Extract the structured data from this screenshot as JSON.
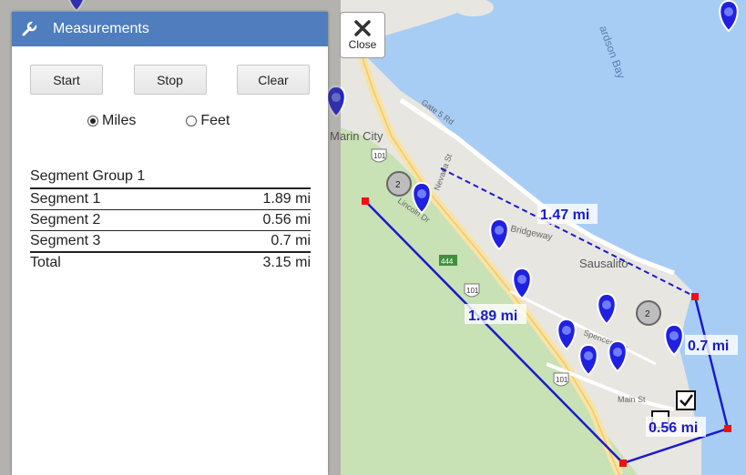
{
  "panel": {
    "title": "Measurements",
    "buttons": {
      "start": "Start",
      "stop": "Stop",
      "clear": "Clear"
    },
    "units": {
      "miles": "Miles",
      "feet": "Feet",
      "selected": "miles"
    },
    "group_title": "Segment Group 1",
    "segments": [
      {
        "label": "Segment 1",
        "value": "1.89 mi"
      },
      {
        "label": "Segment 2",
        "value": "0.56 mi"
      },
      {
        "label": "Segment 3",
        "value": "0.7 mi"
      }
    ],
    "total": {
      "label": "Total",
      "value": "3.15 mi"
    }
  },
  "close_button": {
    "label": "Close"
  },
  "map": {
    "place_labels": {
      "marin_city": "Marin City",
      "sausalito": "Sausalito",
      "bridgeway": "Bridgeway",
      "gate5": "Gate 5 Rd",
      "nevada": "Nevada St",
      "lincoln": "Lincoln Dr",
      "main": "Main St",
      "spencer": "Spencer Ave",
      "bay": "ardson Bay",
      "hwy101a": "101",
      "hwy101b": "101",
      "hwy101c": "101",
      "hwy444": "444",
      "cluster1": "2",
      "cluster2": "2"
    },
    "measure_labels": {
      "seg1": "1.89 mi",
      "seg2": "0.56 mi",
      "seg3": "0.7 mi",
      "pending": "1.47 mi"
    },
    "colors": {
      "water": "#a8cdf5",
      "land": "#e8e6e1",
      "park": "#c8e1b5",
      "line": "#1a1acc",
      "vertex": "#ee1111",
      "panel_header": "#4f7dbd"
    },
    "icons": [
      "map-pin-icon",
      "cluster-icon",
      "checkbox-marker-icon",
      "close-x-icon",
      "wrench-icon"
    ]
  }
}
